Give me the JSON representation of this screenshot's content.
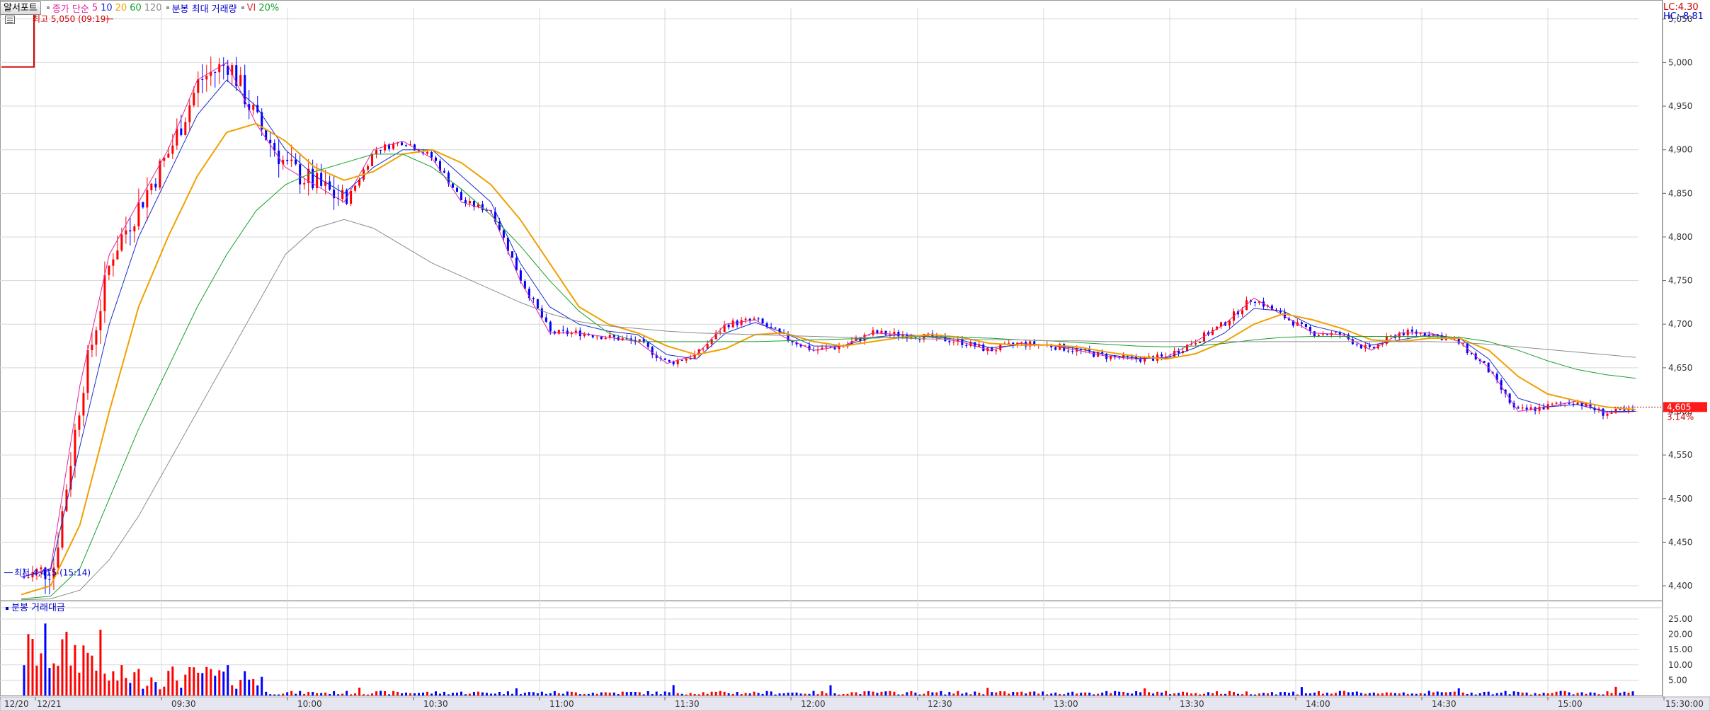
{
  "legend": {
    "tab_label": "알서포트",
    "ma_label": "종가 단순",
    "ma_periods": [
      "5",
      "10",
      "20",
      "60",
      "120"
    ],
    "vi_label": "분봉 최대 거래량",
    "vi_flag": "VI",
    "vi_pct": "20%"
  },
  "colors": {
    "ma5": "#e0249b",
    "ma10": "#1b2ccf",
    "ma20": "#f0a000",
    "ma60": "#16a02a",
    "ma120": "#8c8c8c",
    "up": "#ff0000",
    "down": "#0000ff",
    "grid": "#d8d8d8"
  },
  "price_axis": {
    "lc_label": "LC:4.30",
    "hc_label": "HC:-8.81",
    "ticks": [
      "5,050",
      "5,000",
      "4,950",
      "4,900",
      "4,850",
      "4,800",
      "4,750",
      "4,700",
      "4,650",
      "4,600",
      "4,550",
      "4,500",
      "4,450",
      "4,400"
    ],
    "tick_values": [
      5050,
      5000,
      4950,
      4900,
      4850,
      4800,
      4750,
      4700,
      4650,
      4600,
      4550,
      4500,
      4450,
      4400
    ],
    "current_price": "4,605",
    "current_pct": "3.14%"
  },
  "volume_panel": {
    "title": "분봉 거래대금",
    "ticks": [
      "25.00",
      "20.00",
      "15.00",
      "10.00",
      "5.00"
    ],
    "tick_values": [
      25,
      20,
      15,
      10,
      5
    ]
  },
  "time_axis": {
    "labels": [
      "12/20",
      "12/21",
      "09:30",
      "10:00",
      "10:30",
      "11:00",
      "11:30",
      "12:00",
      "12:30",
      "13:00",
      "13:30",
      "14:00",
      "14:30",
      "15:00",
      "15:30:00"
    ]
  },
  "annotations": {
    "high_label": "최고 5,050 (09:19)",
    "high_value": 5050,
    "low_label": "최저 4,415 (15:14)",
    "low_value": 4415
  },
  "chart_data": {
    "type": "line",
    "title": "",
    "xlabel": "",
    "ylabel": "",
    "ylim": [
      4383,
      5062
    ],
    "x_range": [
      "12/20 close",
      "15:30"
    ],
    "grid": true,
    "series": [
      {
        "name": "5",
        "values": [
          4410,
          4420,
          4630,
          4780,
          4840,
          4900,
          4980,
          5000,
          4930,
          4880,
          4860,
          4840,
          4900,
          4910,
          4890,
          4840,
          4830,
          4750,
          4690,
          4690,
          4685,
          4680,
          4655,
          4665,
          4700,
          4705,
          4685,
          4670,
          4675,
          4690,
          4688,
          4685,
          4680,
          4670,
          4678,
          4676,
          4670,
          4663,
          4660,
          4662,
          4680,
          4700,
          4730,
          4710,
          4690,
          4688,
          4670,
          4690,
          4690,
          4680,
          4650,
          4600,
          4605,
          4612,
          4598,
          4600
        ]
      },
      {
        "name": "10",
        "values": [
          4410,
          4418,
          4560,
          4700,
          4800,
          4870,
          4940,
          4980,
          4950,
          4900,
          4870,
          4850,
          4880,
          4900,
          4900,
          4870,
          4840,
          4770,
          4720,
          4700,
          4692,
          4688,
          4665,
          4660,
          4690,
          4702,
          4690,
          4675,
          4675,
          4685,
          4688,
          4686,
          4682,
          4673,
          4676,
          4676,
          4672,
          4665,
          4661,
          4661,
          4673,
          4690,
          4718,
          4715,
          4698,
          4690,
          4676,
          4682,
          4688,
          4684,
          4660,
          4615,
          4605,
          4608,
          4600,
          4600
        ]
      },
      {
        "name": "20",
        "values": [
          4390,
          4400,
          4470,
          4600,
          4720,
          4800,
          4870,
          4920,
          4930,
          4910,
          4880,
          4865,
          4875,
          4895,
          4900,
          4885,
          4860,
          4820,
          4770,
          4720,
          4700,
          4690,
          4675,
          4665,
          4672,
          4688,
          4690,
          4680,
          4675,
          4680,
          4685,
          4688,
          4685,
          4678,
          4676,
          4676,
          4674,
          4668,
          4663,
          4660,
          4666,
          4680,
          4700,
          4712,
          4705,
          4695,
          4682,
          4680,
          4684,
          4684,
          4670,
          4640,
          4620,
          4612,
          4605,
          4602
        ]
      },
      {
        "name": "60",
        "values": [
          4385,
          4388,
          4420,
          4500,
          4580,
          4650,
          4720,
          4780,
          4830,
          4860,
          4875,
          4885,
          4895,
          4895,
          4880,
          4855,
          4825,
          4790,
          4750,
          4715,
          4690,
          4680,
          4680,
          4680,
          4680,
          4680,
          4681,
          4682,
          4683,
          4684,
          4685,
          4686,
          4685,
          4684,
          4682,
          4681,
          4679,
          4677,
          4675,
          4674,
          4675,
          4678,
          4682,
          4685,
          4686,
          4686,
          4686,
          4686,
          4686,
          4685,
          4680,
          4670,
          4658,
          4648,
          4642,
          4638
        ]
      },
      {
        "name": "120",
        "values": [
          4384,
          4385,
          4395,
          4430,
          4480,
          4540,
          4600,
          4660,
          4720,
          4780,
          4810,
          4820,
          4810,
          4790,
          4770,
          4755,
          4740,
          4725,
          4712,
          4703,
          4698,
          4695,
          4692,
          4690,
          4689,
          4688,
          4687,
          4686,
          4685,
          4685,
          4684,
          4683,
          4683,
          4682,
          4682,
          4681,
          4681,
          4680,
          4680,
          4680,
          4680,
          4680,
          4680,
          4680,
          4680,
          4680,
          4680,
          4680,
          4680,
          4679,
          4677,
          4674,
          4671,
          4668,
          4665,
          4662
        ]
      }
    ]
  }
}
